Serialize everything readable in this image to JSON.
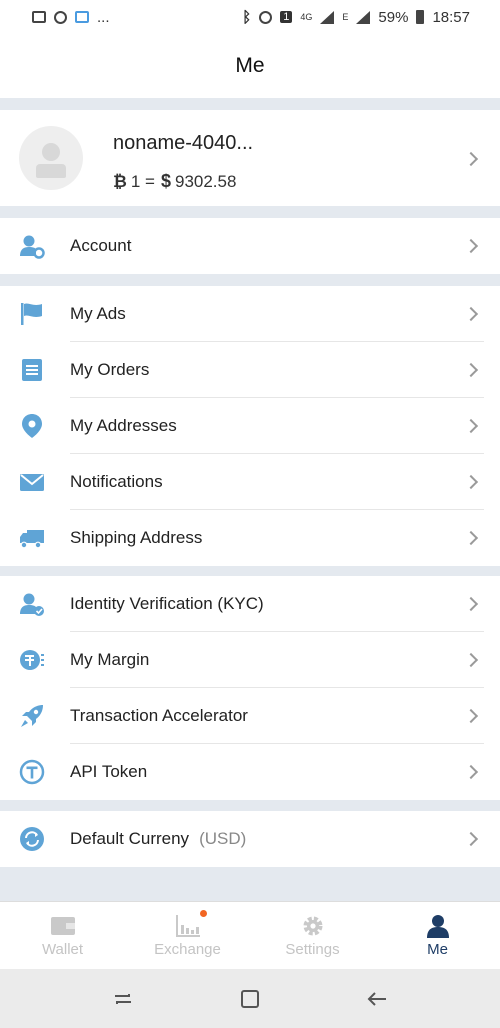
{
  "status_bar": {
    "battery": "59%",
    "time": "18:57",
    "network": "4G",
    "network_e": "E",
    "sim": "1",
    "more": "..."
  },
  "header": {
    "title": "Me"
  },
  "profile": {
    "username": "noname-4040...",
    "btc_symbol": "₿",
    "rate_left": "1 =",
    "usd_symbol": "$",
    "rate_value": "9302.58"
  },
  "menu": {
    "account": "Account",
    "my_ads": "My Ads",
    "my_orders": "My Orders",
    "my_addresses": "My Addresses",
    "notifications": "Notifications",
    "shipping_address": "Shipping Address",
    "kyc": "Identity Verification (KYC)",
    "my_margin": "My Margin",
    "tx_accelerator": "Transaction Accelerator",
    "api_token": "API Token",
    "default_currency": "Default Curreny",
    "default_currency_value": "(USD)"
  },
  "tabs": {
    "wallet": "Wallet",
    "exchange": "Exchange",
    "settings": "Settings",
    "me": "Me"
  },
  "colors": {
    "icon_blue": "#5fa4d6",
    "active_tab": "#1e3d66",
    "badge": "#f26522"
  }
}
